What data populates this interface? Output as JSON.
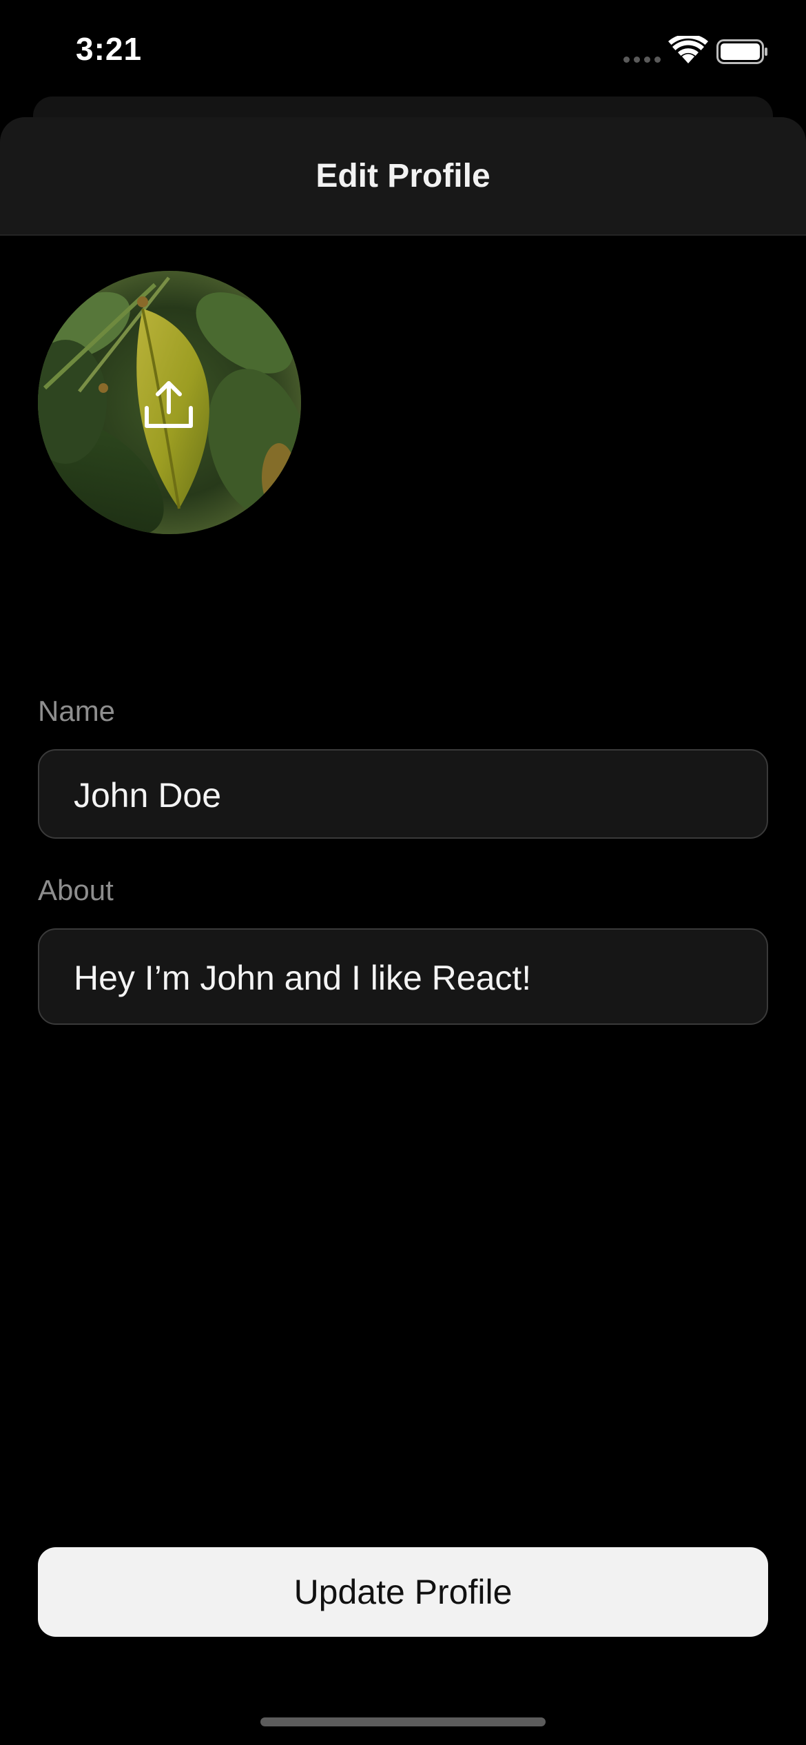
{
  "status_bar": {
    "time": "3:21",
    "icons": [
      "signal-dots-icon",
      "wifi-icon",
      "battery-icon"
    ]
  },
  "sheet": {
    "title": "Edit Profile"
  },
  "avatar": {
    "image": "leaf-photo",
    "overlay_icon": "upload-icon"
  },
  "form": {
    "name_label": "Name",
    "name_value": "John Doe",
    "about_label": "About",
    "about_value": "Hey I’m John and I like React!"
  },
  "actions": {
    "update_label": "Update Profile"
  },
  "colors": {
    "background": "#000000",
    "sheet_header": "#181818",
    "field_background": "#161616",
    "field_border": "#3a3a3a",
    "label_text": "#8e8e8e",
    "button_background": "#f2f2f2",
    "button_text": "#111111"
  }
}
